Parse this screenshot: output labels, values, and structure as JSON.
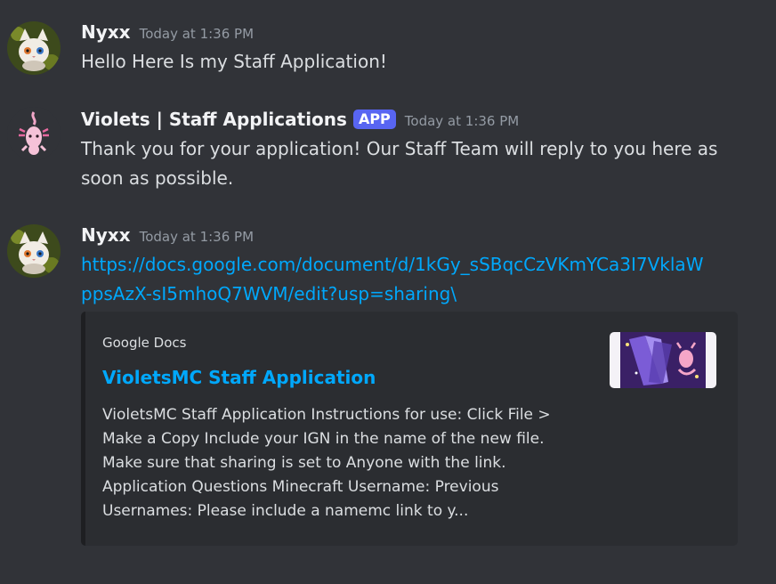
{
  "messages": [
    {
      "author": "Nyxx",
      "timestamp": "Today at 1:36 PM",
      "text": "Hello Here Is my Staff Application!",
      "avatar_icon": "cat-avatar"
    },
    {
      "author": "Violets | Staff Applications",
      "badge": "APP",
      "timestamp": "Today at 1:36 PM",
      "lines": [
        "Thank you for your application! Our Staff Team will reply to you here as",
        "soon as possible."
      ],
      "avatar_icon": "axolotl-avatar"
    },
    {
      "author": "Nyxx",
      "timestamp": "Today at 1:36 PM",
      "link_lines": [
        "https://docs.google.com/document/d/1kGy_sSBqcCzVKmYCa3I7VklaW",
        "ppsAzX-sI5mhoQ7WVM/edit?usp=sharing\\"
      ],
      "avatar_icon": "cat-avatar",
      "embed": {
        "provider": "Google Docs",
        "title": "VioletsMC Staff Application",
        "description_lines": [
          "VioletsMC Staff Application Instructions for use: Click File >",
          "Make a Copy Include your IGN in the name of the new file.",
          "Make sure that sharing is set to Anyone with the link.",
          "Application Questions Minecraft Username: Previous",
          "Usernames: Please include a namemc link to y..."
        ],
        "thumbnail_icon": "violetsmc-thumbnail"
      }
    }
  ],
  "colors": {
    "background": "#313338",
    "embed_background": "#2b2d31",
    "link": "#00a8fc",
    "badge": "#5865f2",
    "timestamp": "#949ba4"
  }
}
